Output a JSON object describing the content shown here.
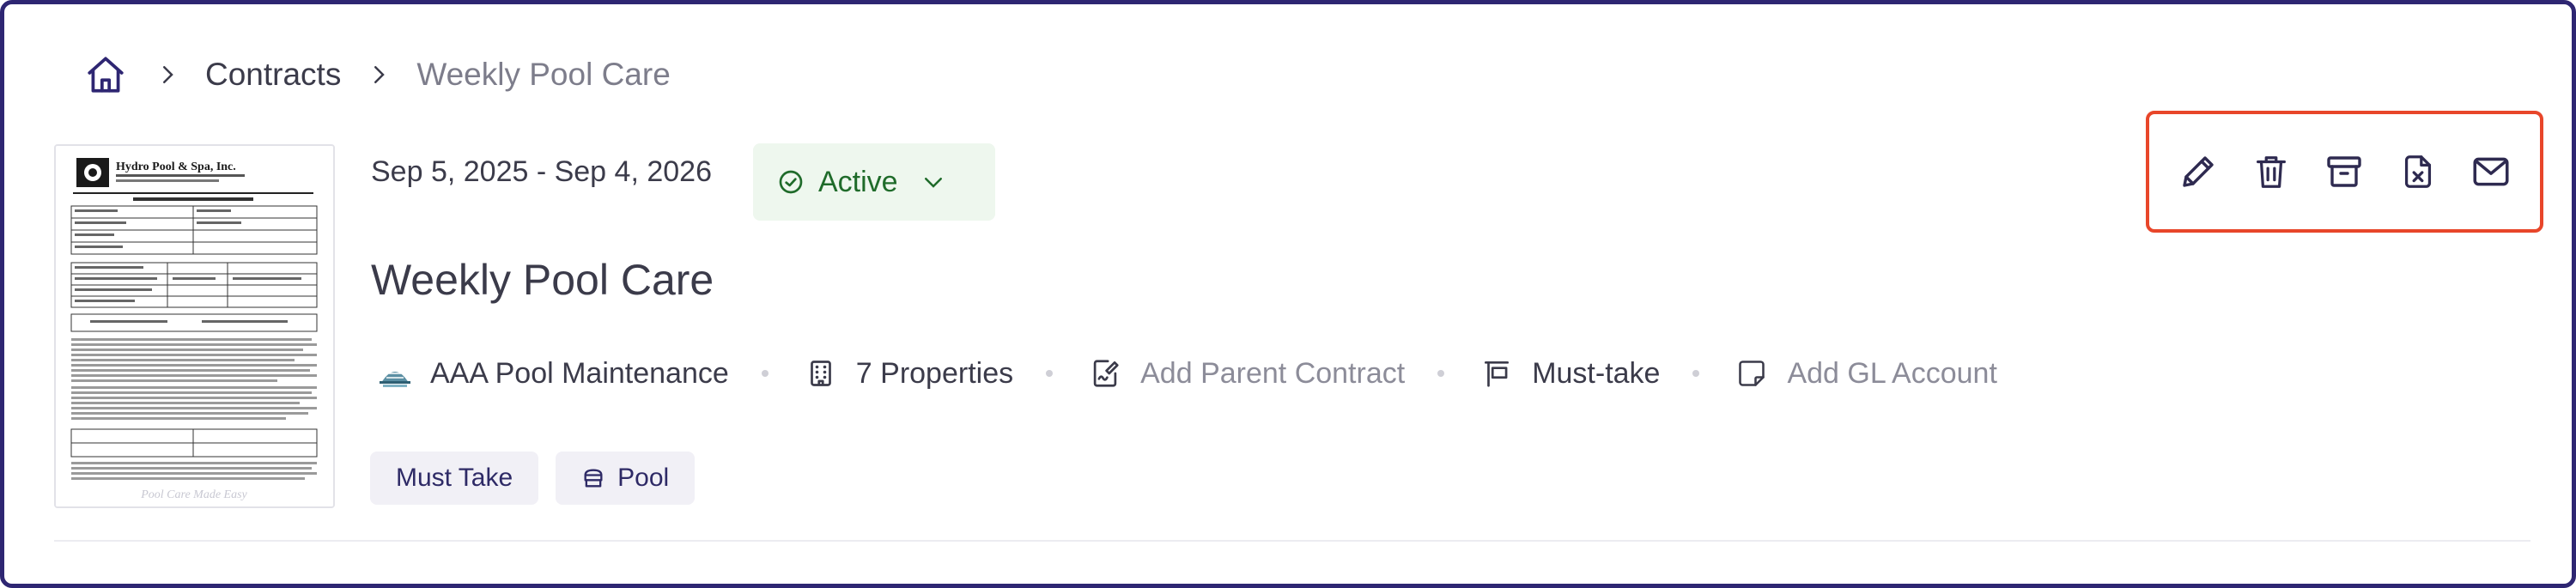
{
  "breadcrumb": {
    "home_icon": "home-icon",
    "items": [
      {
        "label": "Contracts"
      },
      {
        "label": "Weekly Pool Care"
      }
    ]
  },
  "contract": {
    "date_range": "Sep 5, 2025 - Sep 4, 2026",
    "status": {
      "label": "Active",
      "color": "#1f6b2a",
      "background": "#eef7ee"
    },
    "title": "Weekly Pool Care",
    "thumbnail": {
      "company": "Hydro Pool & Spa, Inc.",
      "footer": "Pool Care Made Easy"
    }
  },
  "meta": {
    "vendor": "AAA Pool Maintenance",
    "properties": "7 Properties",
    "parent_contract": "Add Parent Contract",
    "priority": "Must-take",
    "gl_account": "Add GL Account"
  },
  "tags": [
    {
      "label": "Must Take",
      "icon": ""
    },
    {
      "label": "Pool",
      "icon": "pool-icon"
    }
  ],
  "actions": [
    {
      "name": "edit",
      "icon": "pencil-icon"
    },
    {
      "name": "delete",
      "icon": "trash-icon"
    },
    {
      "name": "archive",
      "icon": "archive-icon"
    },
    {
      "name": "cancel",
      "icon": "document-x-icon"
    },
    {
      "name": "email",
      "icon": "envelope-icon"
    }
  ],
  "colors": {
    "frame": "#2e2672",
    "highlight": "#e8462a",
    "accent": "#2e2a66"
  }
}
